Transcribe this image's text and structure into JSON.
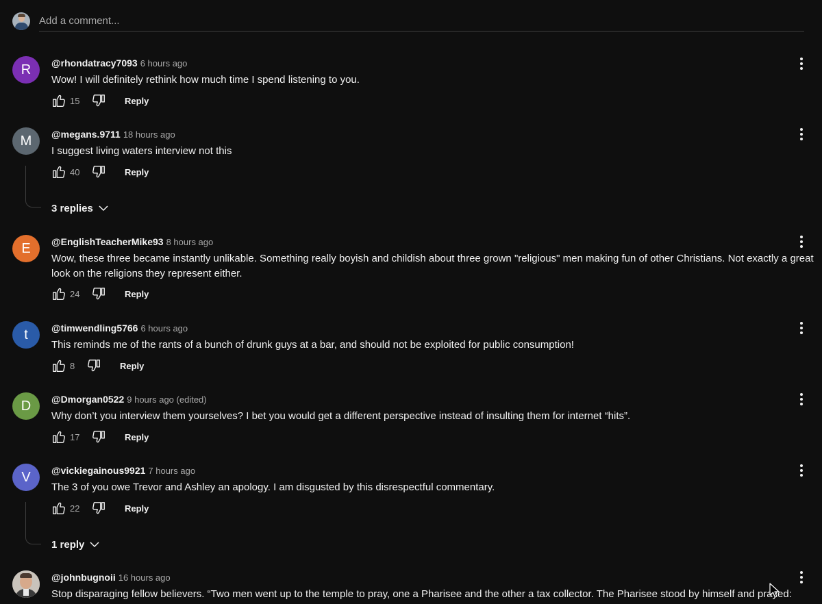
{
  "add_comment": {
    "placeholder": "Add a comment..."
  },
  "comments": [
    {
      "avatar_letter": "R",
      "avatar_color": "#7b2fb3",
      "author": "@rhondatracy7093",
      "time": "6 hours ago",
      "text": "Wow! I will definitely rethink how much time I spend listening to you.",
      "likes": "15",
      "reply_label": "Reply"
    },
    {
      "avatar_letter": "M",
      "avatar_color": "#5c6770",
      "author": "@megans.9711",
      "time": "18 hours ago",
      "text": "I suggest living waters interview not this",
      "likes": "40",
      "reply_label": "Reply",
      "replies_label": "3 replies"
    },
    {
      "avatar_letter": "E",
      "avatar_color": "#e36f2c",
      "author": "@EnglishTeacherMike93",
      "time": "8 hours ago",
      "text": "Wow, these three became instantly unlikable.  Something really boyish and childish about three grown \"religious\" men making fun of other Christians. Not exactly a great look on the religions they represent either.",
      "likes": "24",
      "reply_label": "Reply"
    },
    {
      "avatar_letter": "t",
      "avatar_color": "#2a5ba8",
      "author": "@timwendling5766",
      "time": "6 hours ago",
      "text": "This reminds me of the rants of a bunch of drunk guys at a bar, and should not be exploited for public consumption!",
      "likes": "8",
      "reply_label": "Reply"
    },
    {
      "avatar_letter": "D",
      "avatar_color": "#6a9a45",
      "author": "@Dmorgan0522",
      "time": "9 hours ago (edited)",
      "text": "Why don’t you interview them yourselves?  I bet you would get a different perspective instead of insulting them for internet “hits”.",
      "likes": "17",
      "reply_label": "Reply"
    },
    {
      "avatar_letter": "V",
      "avatar_color": "#5b64c9",
      "author": "@vickiegainous9921",
      "time": "7 hours ago",
      "text": "The 3 of you owe Trevor and Ashley an apology.  I am disgusted by this disrespectful commentary.",
      "likes": "22",
      "reply_label": "Reply",
      "replies_label": "1 reply"
    },
    {
      "avatar_letter": "",
      "author": "@johnbugnoii",
      "time": "16 hours ago",
      "text": "Stop disparaging fellow believers. “Two men went up to the temple to pray, one a Pharisee and the other a tax collector. The Pharisee stood by himself and prayed:"
    }
  ],
  "colors": {
    "background": "#0f0f0f",
    "text_primary": "#f1f1f1",
    "text_secondary": "#aaaaaa",
    "divider": "#3f3f3f"
  }
}
